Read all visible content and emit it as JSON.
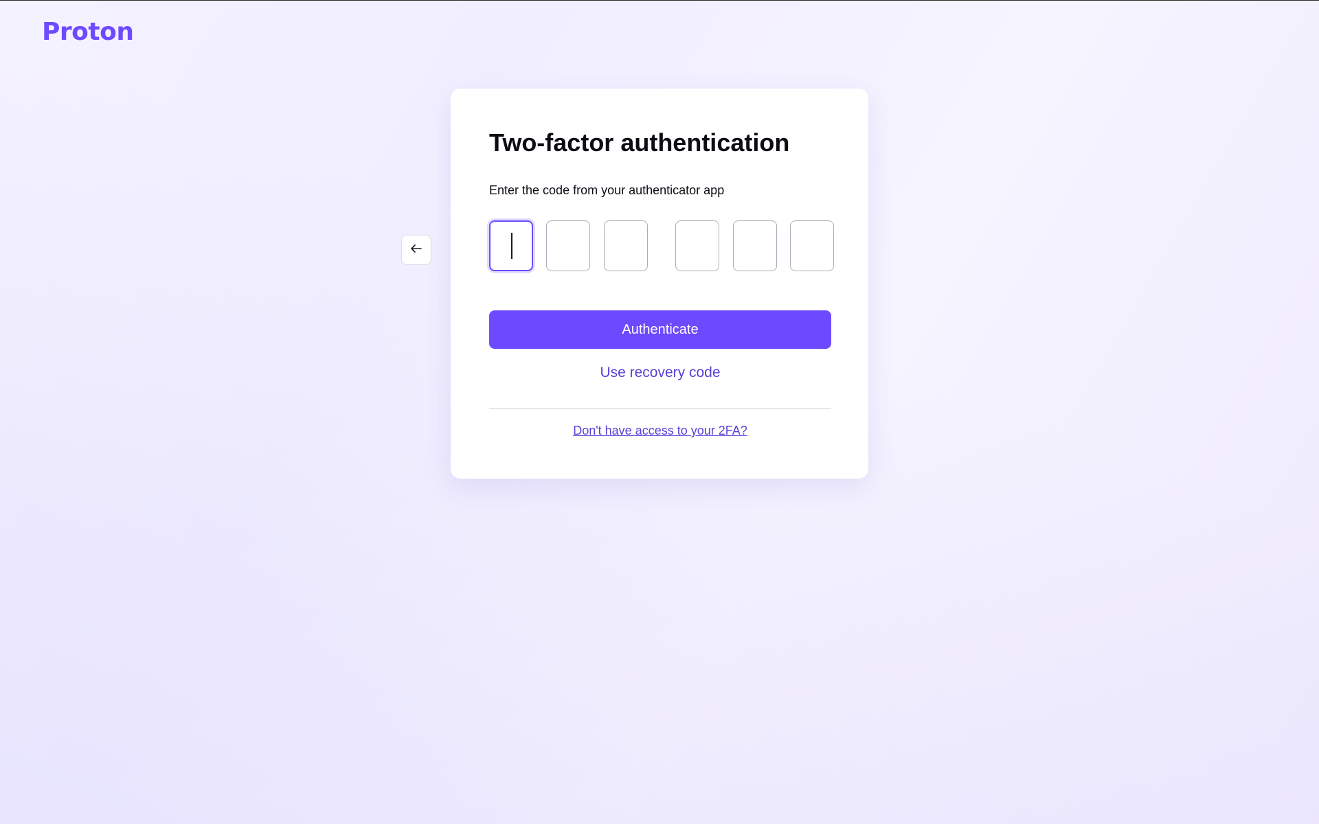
{
  "brand": {
    "logo_text": "Proton",
    "accent_color": "#6d4aff"
  },
  "navigation": {
    "back_icon": "arrow-left-icon"
  },
  "auth_card": {
    "title": "Two-factor authentication",
    "subtitle": "Enter the code from your authenticator app",
    "code_fields": [
      {
        "value": "",
        "focused": true
      },
      {
        "value": "",
        "focused": false
      },
      {
        "value": "",
        "focused": false
      },
      {
        "value": "",
        "focused": false
      },
      {
        "value": "",
        "focused": false
      },
      {
        "value": "",
        "focused": false
      }
    ],
    "authenticate_label": "Authenticate",
    "recovery_label": "Use recovery code",
    "help_link_label": "Don't have access to your 2FA?"
  }
}
